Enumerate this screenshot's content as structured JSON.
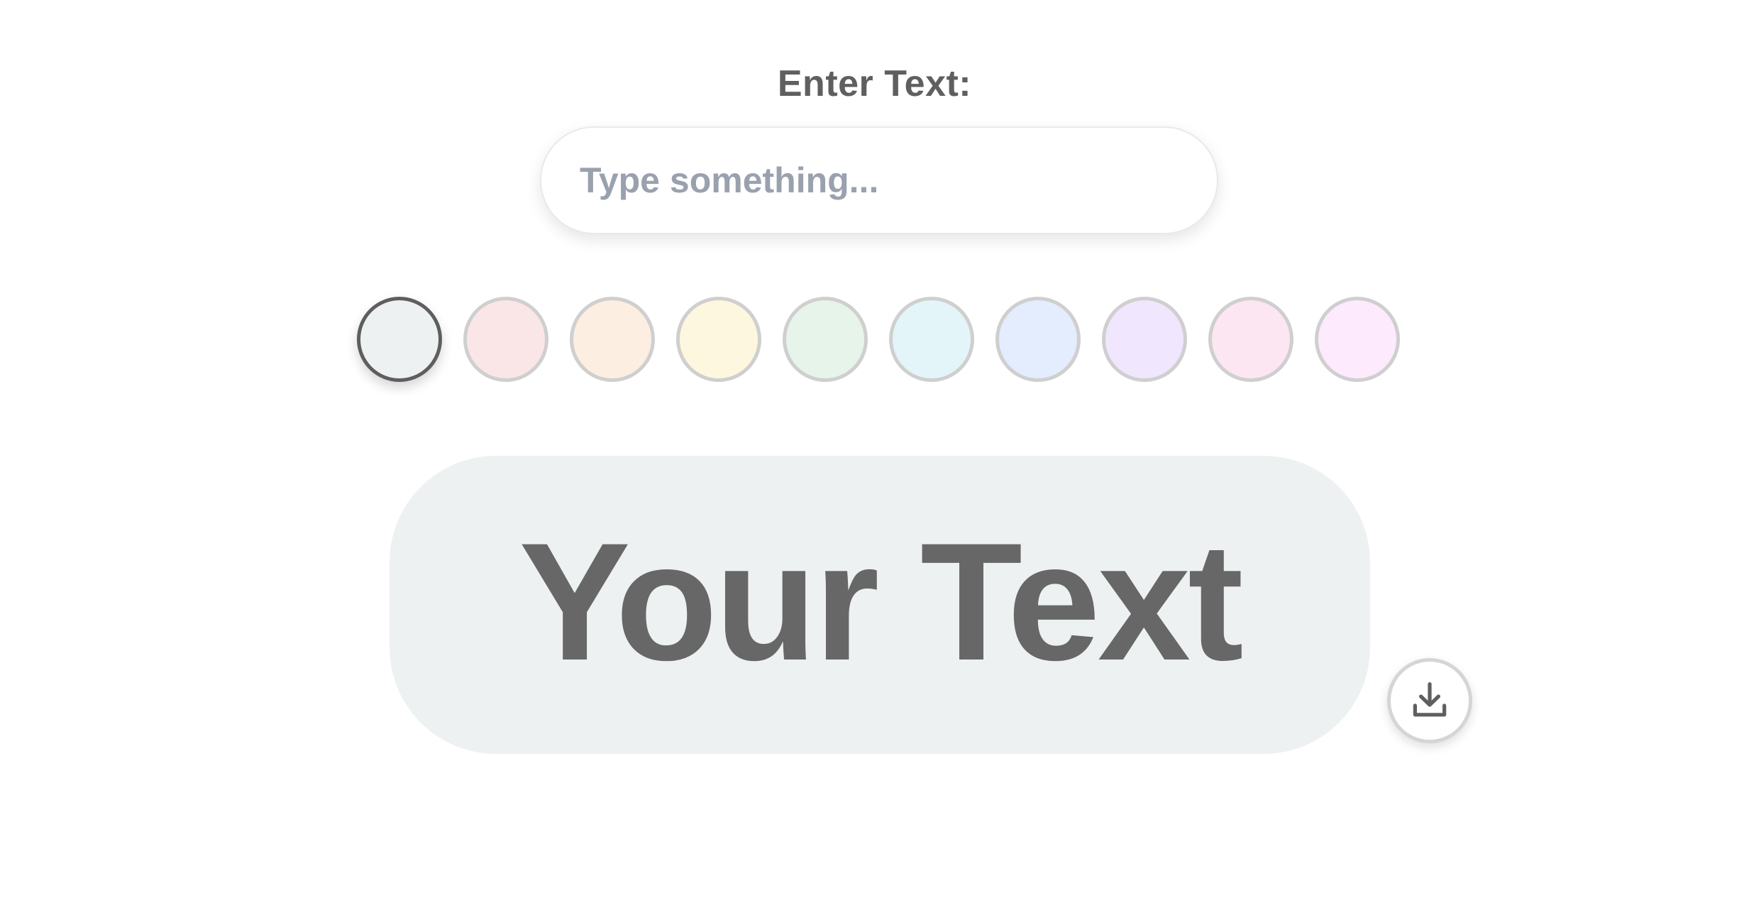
{
  "form": {
    "label": "Enter Text:",
    "input_value": "",
    "input_placeholder": "Type something..."
  },
  "swatches": [
    {
      "name": "swatch-gray",
      "color": "#eef1f2",
      "selected": true
    },
    {
      "name": "swatch-red",
      "color": "#fbe6e7",
      "selected": false
    },
    {
      "name": "swatch-orange",
      "color": "#fdeee2",
      "selected": false
    },
    {
      "name": "swatch-yellow",
      "color": "#fdf7df",
      "selected": false
    },
    {
      "name": "swatch-green",
      "color": "#e6f4ea",
      "selected": false
    },
    {
      "name": "swatch-cyan",
      "color": "#e3f5f8",
      "selected": false
    },
    {
      "name": "swatch-blue",
      "color": "#e4edfd",
      "selected": false
    },
    {
      "name": "swatch-purple",
      "color": "#f0e6fd",
      "selected": false
    },
    {
      "name": "swatch-pink",
      "color": "#fce6f1",
      "selected": false
    },
    {
      "name": "swatch-magenta",
      "color": "#fdeafd",
      "selected": false
    }
  ],
  "preview": {
    "text": "Your Text",
    "background": "#eef1f2",
    "text_color": "#676767"
  },
  "download": {
    "icon": "download-icon"
  }
}
